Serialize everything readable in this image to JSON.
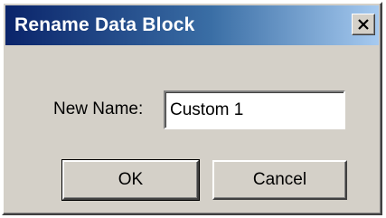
{
  "window": {
    "title": "Rename Data Block",
    "close_icon": "close-icon"
  },
  "form": {
    "name_label": "New Name:",
    "name_value": "Custom 1"
  },
  "buttons": {
    "ok_label": "OK",
    "cancel_label": "Cancel"
  },
  "colors": {
    "titlebar_start": "#0a246a",
    "titlebar_end": "#a6caf0",
    "dialog_face": "#d4d0c8"
  }
}
